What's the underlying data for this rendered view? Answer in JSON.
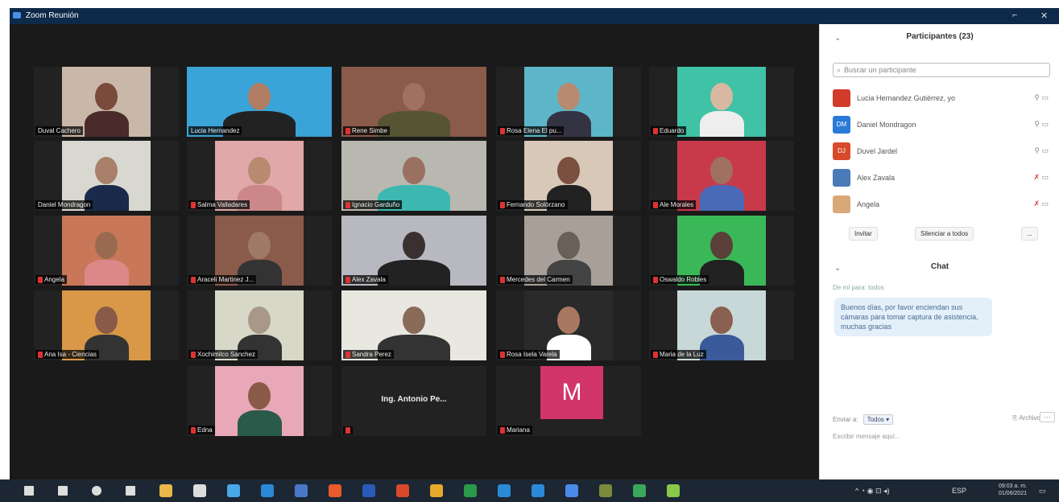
{
  "window": {
    "title": "Zoom Reunión",
    "min": "⌐",
    "close": "✕"
  },
  "tiles": [
    {
      "name": "Duval Cachero",
      "muted": false,
      "highlight": false,
      "bg": "#c9b8a9",
      "skin": "#7a4a3a",
      "shirt": "#4a2a2a"
    },
    {
      "name": "Lucia Hernandez",
      "muted": false,
      "highlight": true,
      "bg": "#3aa3d8",
      "skin": "#b07c62",
      "shirt": "#222"
    },
    {
      "name": "Rene Simbe",
      "muted": true,
      "highlight": false,
      "bg": "#8a5a4a",
      "skin": "#a07060",
      "shirt": "#553"
    },
    {
      "name": "Rosa Elena El pu...",
      "muted": true,
      "highlight": false,
      "bg": "#5cb6c8",
      "skin": "#b88a70",
      "shirt": "#334"
    },
    {
      "name": "Eduardo",
      "muted": true,
      "highlight": false,
      "bg": "#3fc2a6",
      "skin": "#d8b8a0",
      "shirt": "#eee"
    },
    {
      "name": "Daniel Mondragon",
      "muted": false,
      "highlight": false,
      "bg": "#d8d8d0",
      "skin": "#a8806a",
      "shirt": "#1a2a4a"
    },
    {
      "name": "Salma Valladares",
      "muted": true,
      "highlight": false,
      "bg": "#e0a8a8",
      "skin": "#b88a70",
      "shirt": "#c88"
    },
    {
      "name": "Ignacio Garduño",
      "muted": true,
      "highlight": false,
      "bg": "#b8b8b0",
      "skin": "#9a7060",
      "shirt": "#3cb8b0"
    },
    {
      "name": "Fernando Solórzano",
      "muted": true,
      "highlight": false,
      "bg": "#d8c8b8",
      "skin": "#7a5040",
      "shirt": "#222"
    },
    {
      "name": "Ale Morales",
      "muted": true,
      "highlight": false,
      "bg": "#c83a4a",
      "skin": "#a07060",
      "shirt": "#4a6ab8"
    },
    {
      "name": "Angela",
      "muted": true,
      "highlight": false,
      "bg": "#c87858",
      "skin": "#9a6a50",
      "shirt": "#d88"
    },
    {
      "name": "Araceli Martinez J...",
      "muted": true,
      "highlight": false,
      "bg": "#8a5a4a",
      "skin": "#a07868",
      "shirt": "#333"
    },
    {
      "name": "Alex Zavala",
      "muted": true,
      "highlight": false,
      "bg": "#b8b8c0",
      "skin": "#3a3030",
      "shirt": "#222"
    },
    {
      "name": "Mercedes del Carmen",
      "muted": true,
      "highlight": false,
      "bg": "#a8a098",
      "skin": "#6a6058",
      "shirt": "#444"
    },
    {
      "name": "Oswaldo Robles",
      "muted": true,
      "highlight": false,
      "bg": "#3ab858",
      "skin": "#5a4038",
      "shirt": "#222"
    },
    {
      "name": "Ana Isa - Ciencias",
      "muted": true,
      "highlight": false,
      "bg": "#d89848",
      "skin": "#8a5a48",
      "shirt": "#333"
    },
    {
      "name": "Xochimilco Sanchez",
      "muted": true,
      "highlight": false,
      "bg": "#d8d8c8",
      "skin": "#a89888",
      "shirt": "#333"
    },
    {
      "name": "Sandra Perez",
      "muted": true,
      "highlight": false,
      "bg": "#e8e8e0",
      "skin": "#8a6a58",
      "shirt": "#333"
    },
    {
      "name": "Rosa Isela Varela",
      "muted": true,
      "highlight": false,
      "bg": "#2a2a2a",
      "skin": "#a87860",
      "shirt": "#fff"
    },
    {
      "name": "Maria de la Luz",
      "muted": true,
      "highlight": false,
      "bg": "#c8d8d8",
      "skin": "#8a6050",
      "shirt": "#3a5a9a"
    },
    {
      "name": "Edna",
      "muted": true,
      "highlight": false,
      "bg": "#e8a8b8",
      "skin": "#8a5a48",
      "shirt": "#2a5a4a"
    },
    {
      "name": "Ing. Antonio Pe...",
      "muted": true,
      "highlight": false,
      "textonly": true
    },
    {
      "name": "Mariana",
      "muted": true,
      "highlight": false,
      "letter": "M"
    }
  ],
  "panel": {
    "title": "Participantes (23)",
    "search_placeholder": "Buscar un participante",
    "participants": [
      {
        "name": "Lucia Hernandez Gutiérrez, yo",
        "avatar": "",
        "color": "#d23a2a",
        "muted": false
      },
      {
        "name": "Daniel Mondragon",
        "avatar": "DM",
        "color": "#2a7ad8",
        "muted": false
      },
      {
        "name": "Duvel Jardel",
        "avatar": "DJ",
        "color": "#d84a2a",
        "muted": false
      },
      {
        "name": "Alex Zavala",
        "avatar": "",
        "color": "#4a7ab8",
        "muted": true
      },
      {
        "name": "Angela",
        "avatar": "",
        "color": "#d8a878",
        "muted": true
      }
    ],
    "invite": "Invitar",
    "mute_all": "Silenciar a todos",
    "more": "...",
    "chat_title": "Chat",
    "chat_from": "De mí para: todos",
    "chat_message": "Buenos días, por favor enciendan sus cámaras para tomar captura de asistencia, muchas gracias",
    "send_to_label": "Enviar a:",
    "send_to_value": "Todos ▾",
    "file_label": "Archivo",
    "chat_placeholder": "Escribir mensaje aquí..."
  },
  "taskbar": {
    "tray_lang": "ESP",
    "time": "09:03 a. m.",
    "date": "01/06/2021"
  }
}
